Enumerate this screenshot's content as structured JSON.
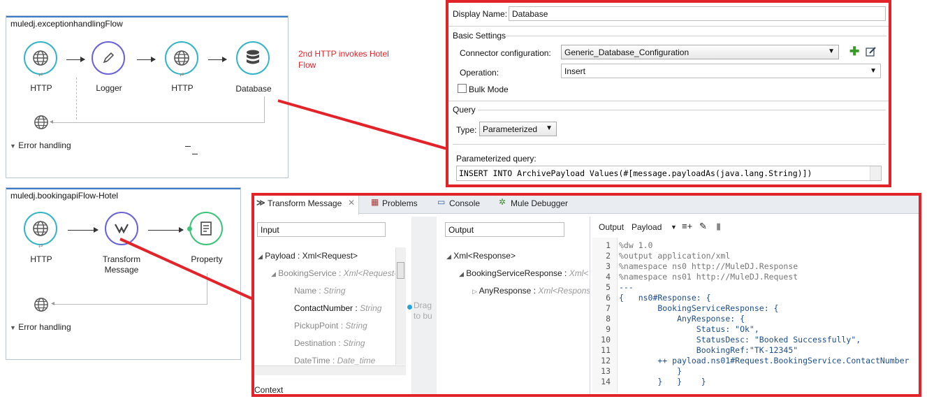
{
  "flow1": {
    "title": "muledj.exceptionhandlingFlow",
    "nodes": [
      "HTTP",
      "Logger",
      "HTTP",
      "Database"
    ],
    "error_handling": "Error handling"
  },
  "annotation": "2nd HTTP invokes Hotel Flow",
  "flow2": {
    "title": "muledj.bookingapiFlow-Hotel",
    "nodes": [
      "HTTP",
      "Transform Message",
      "Property"
    ],
    "error_handling": "Error handling"
  },
  "db_props": {
    "display_name_label": "Display Name:",
    "display_name_value": "Database",
    "basic_settings": "Basic Settings",
    "connector_label": "Connector configuration:",
    "connector_value": "Generic_Database_Configuration",
    "operation_label": "Operation:",
    "operation_value": "Insert",
    "bulk_mode": "Bulk Mode",
    "query_group": "Query",
    "type_label": "Type:",
    "type_value": "Parameterized",
    "param_query_label": "Parameterized query:",
    "query_text": "INSERT INTO ArchivePayload Values(#[message.payloadAs(java.lang.String)])"
  },
  "editor": {
    "tabs": [
      "Transform Message",
      "Problems",
      "Console",
      "Mule Debugger"
    ],
    "input_label": "Input",
    "output_label": "Output",
    "input_tree": [
      {
        "name": "Payload",
        "type": "Xml<Request>"
      },
      {
        "name": "BookingService",
        "type": "Xml<Request-"
      },
      {
        "name": "Name",
        "type": "String"
      },
      {
        "name": "ContactNumber",
        "type": "String"
      },
      {
        "name": "PickupPoint",
        "type": "String"
      },
      {
        "name": "Destination",
        "type": "String"
      },
      {
        "name": "DateTime",
        "type": "Date_time"
      }
    ],
    "drag_hint": "Drag to bu",
    "output_tree": [
      {
        "name": "Xml<Response>",
        "type": ""
      },
      {
        "name": "BookingServiceResponse",
        "type": "Xml<"
      },
      {
        "name": "AnyResponse",
        "type": "Xml<Respons"
      }
    ],
    "context_label": "Context",
    "output_toolbar_label": "Output",
    "output_target": "Payload",
    "code_lines": [
      "%dw 1.0",
      "%output application/xml",
      "%namespace ns0 http://MuleDJ.Response",
      "%namespace ns01 http://MuleDJ.Request",
      "---",
      "{   ns0#Response: {",
      "        BookingServiceResponse: {",
      "            AnyResponse: {",
      "                Status: \"Ok\",",
      "                StatusDesc: \"Booked Successfully\",",
      "                BookingRef:\"TK-12345\"",
      "        ++ payload.ns01#Request.BookingService.ContactNumber",
      "            }",
      "        }   }    }"
    ]
  }
}
